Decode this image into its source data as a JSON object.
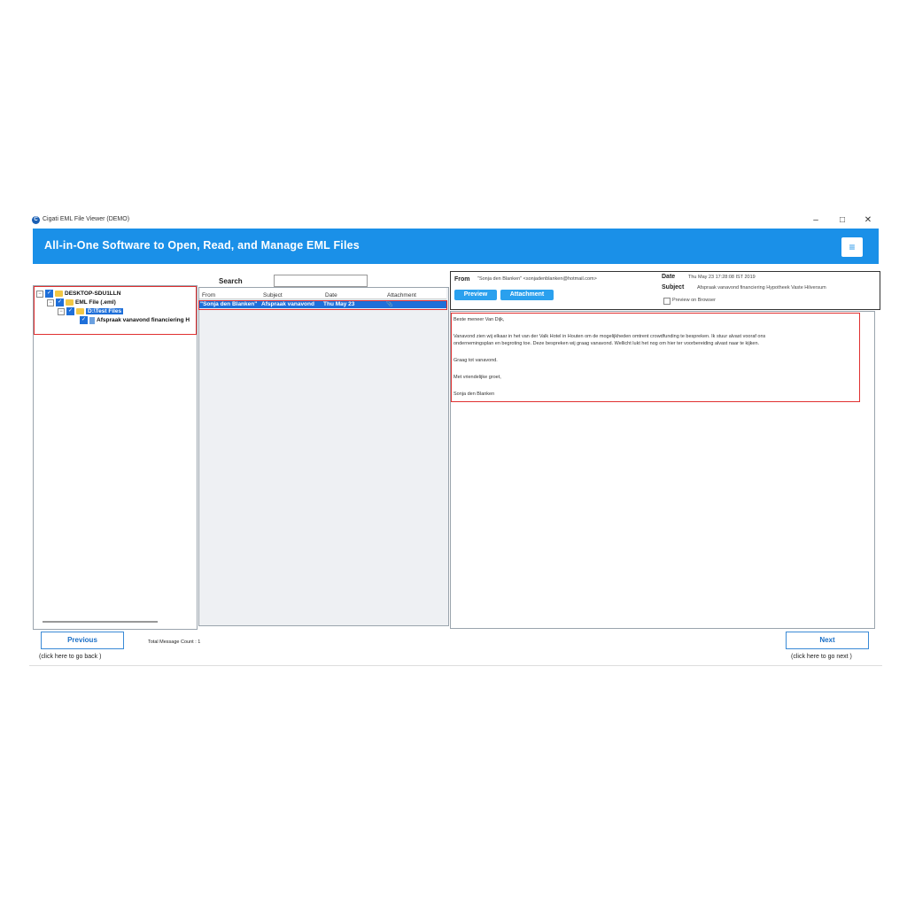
{
  "window": {
    "title": "Cigati EML File Viewer (DEMO)",
    "app_icon_letter": "C",
    "controls": {
      "minimize": "–",
      "restore": "□",
      "close": "✕"
    }
  },
  "banner": {
    "title": "All-in-One Software to Open, Read, and Manage EML Files",
    "menu_icon": "≡"
  },
  "tree": {
    "root": "DESKTOP-SDU1LLN",
    "level1": "EML File (.eml)",
    "level2": "D:\\Test Files",
    "level3": "Afspraak vanavond financiering H"
  },
  "search": {
    "label": "Search",
    "placeholder": ""
  },
  "list": {
    "columns": [
      "From",
      "Subject",
      "Date",
      "Attachment"
    ],
    "rows": [
      {
        "from": "\"Sonja den Blanken\"",
        "subject": "Afspraak vanavond",
        "date": "Thu May 23",
        "attachment": "📎"
      }
    ]
  },
  "header": {
    "from_label": "From",
    "from_value": "\"Sonja den Blanken\" <sonjadenblanken@hotmail.com>",
    "date_label": "Date",
    "date_value": "Thu May 23 17:28:08 IST 2019",
    "subject_label": "Subject",
    "subject_value": "Afspraak vanavond financiering Hypotheek Vaste Hilversum",
    "preview_tab": "Preview",
    "attachment_tab": "Attachment",
    "preview_browser": "Preview on Browser"
  },
  "message": {
    "lines": [
      "Beste meneer Van Dijk,",
      "Vanavond zien wij elkaar in het van der Valk Hotel in Houten om de mogelijkheden omtrent crowdfunding te bespreken. Ik stuur alvast vooraf ons",
      "ondernemingsplan en begroting toe. Deze bespreken wij graag vanavond. Wellicht lukt het nog om hier ter voorbereiding alvast naar te kijken.",
      "Graag tot vanavond.",
      "Met vriendelijke groet,",
      "Sonja den Blanken"
    ]
  },
  "footer": {
    "previous_label": "Previous",
    "previous_hint": "(click here to  go back )",
    "count_text": "Total Message Count : 1",
    "next_label": "Next",
    "next_hint": "(click here to  go next )"
  },
  "colors": {
    "accent": "#1a90e8",
    "selection": "#1e6fd9",
    "highlight_box": "#e03030"
  }
}
